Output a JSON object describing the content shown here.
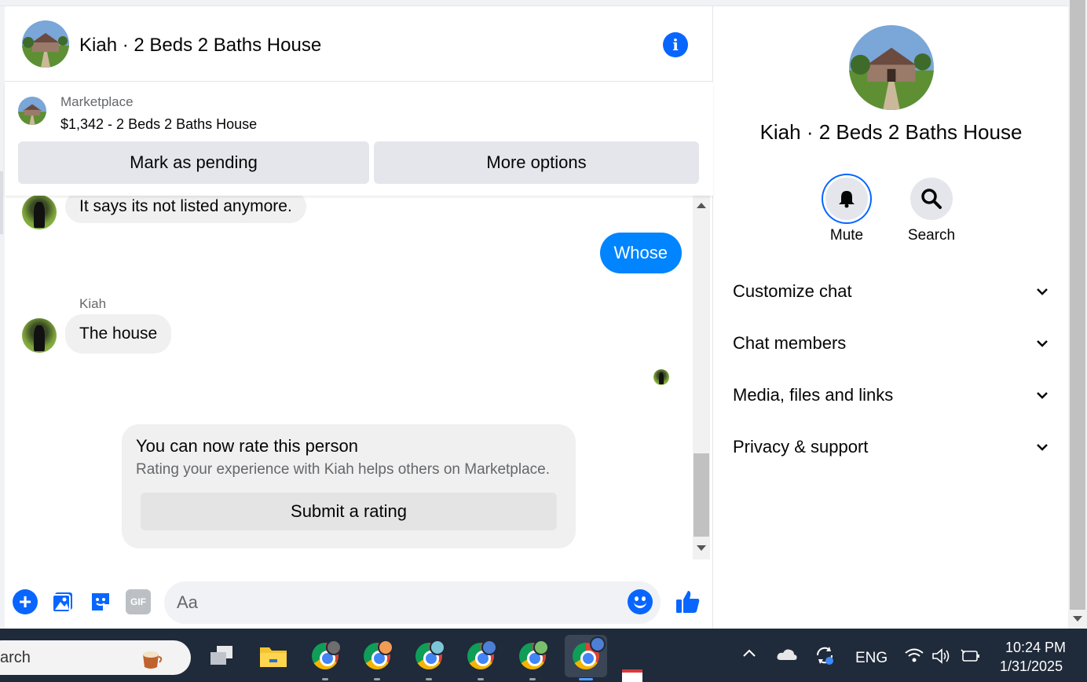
{
  "chat": {
    "title": "Kiah · 2 Beds 2 Baths House",
    "listing": {
      "label": "Marketplace",
      "price_title": "$1,342 - 2 Beds 2 Baths House",
      "mark_pending": "Mark as pending",
      "more_options": "More options"
    },
    "messages": {
      "m1": "It says its not listed anymore.",
      "m2": "Whose",
      "sender": "Kiah",
      "m3": "The house"
    },
    "rating": {
      "title": "You can now rate this person",
      "subtitle": "Rating your experience with Kiah helps others on Marketplace.",
      "button": "Submit a rating"
    },
    "composer": {
      "placeholder": "Aa",
      "gif_label": "GIF"
    }
  },
  "details": {
    "name": "Kiah · 2 Beds 2 Baths House",
    "mute_label": "Mute",
    "search_label": "Search",
    "sections": [
      "Customize chat",
      "Chat members",
      "Media, files and links",
      "Privacy & support"
    ]
  },
  "taskbar": {
    "search_text": "arch",
    "lang": "ENG",
    "time": "10:24 PM",
    "date": "1/31/2025"
  },
  "colors": {
    "accent": "#0866ff",
    "bubble_out": "#0084ff",
    "taskbar": "#1f2a3a"
  }
}
